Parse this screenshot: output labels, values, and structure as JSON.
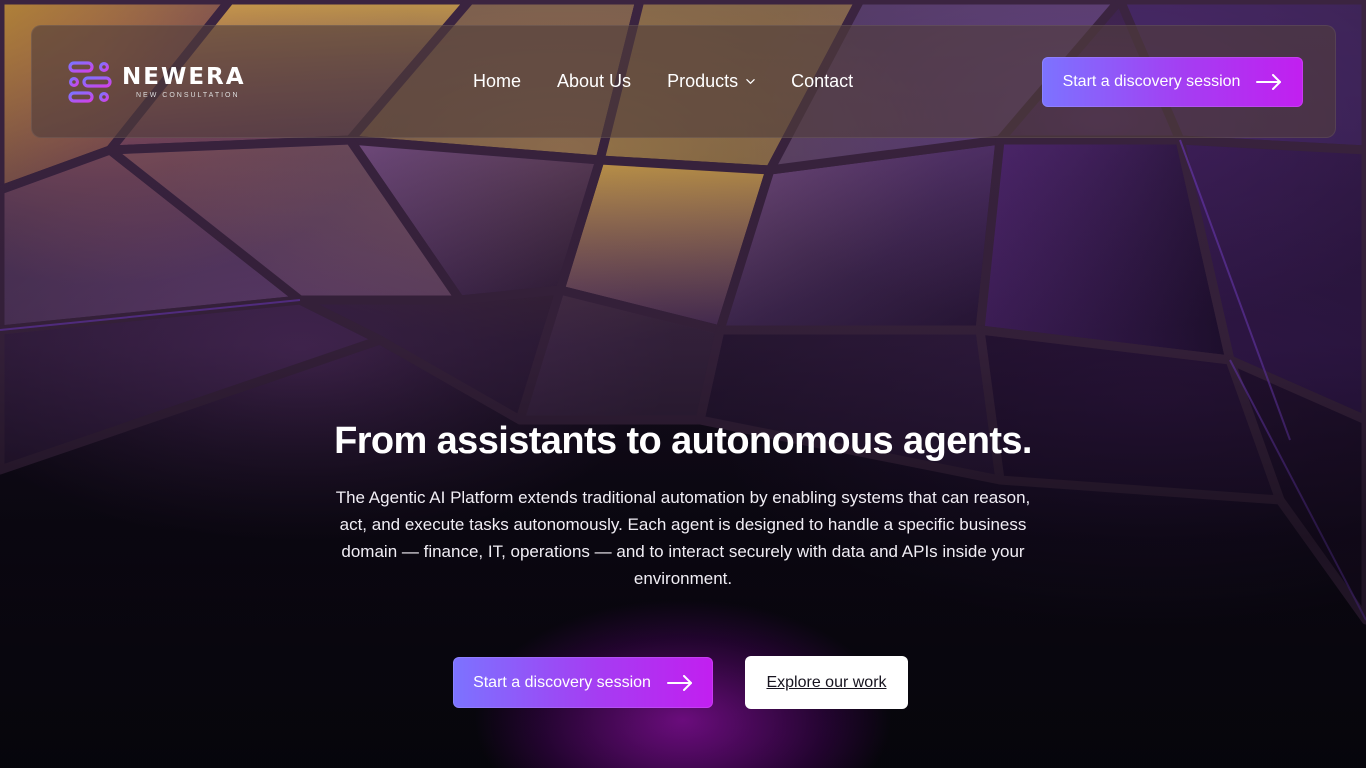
{
  "brand": {
    "name": "NEWERA",
    "tagline": "NEW CONSULTATION"
  },
  "nav": {
    "items": [
      {
        "label": "Home"
      },
      {
        "label": "About Us"
      },
      {
        "label": "Products",
        "icon": "chevron-down-icon"
      },
      {
        "label": "Contact"
      }
    ],
    "cta_label": "Start a discovery session",
    "cta_icon": "arrow-right-icon"
  },
  "hero": {
    "headline": "From assistants to autonomous agents.",
    "description": "The Agentic AI Platform extends traditional automation by enabling systems that can reason, act, and execute tasks autonomously. Each agent is designed to handle a specific business domain — finance, IT, operations — and to interact securely with data and APIs inside your environment.",
    "primary_cta": "Start a discovery session",
    "secondary_cta": "Explore our work"
  },
  "colors": {
    "accent_start": "#7c73ff",
    "accent_end": "#c21ff0",
    "glow": "#b414e0",
    "background": "#07060c"
  }
}
